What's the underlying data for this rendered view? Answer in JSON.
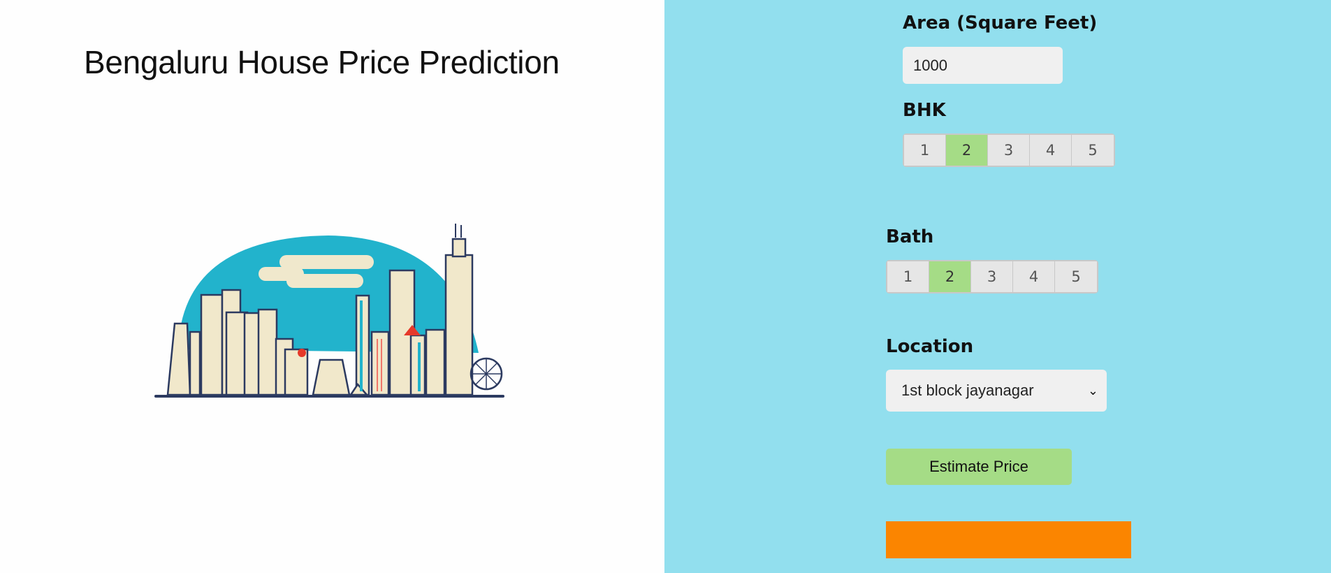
{
  "header": {
    "title": "Bengaluru House Price Prediction"
  },
  "illustration": {
    "icon": "bangalore-skyline-illustration"
  },
  "form": {
    "area": {
      "label": "Area (Square Feet)",
      "value": "1000"
    },
    "bhk": {
      "label": "BHK",
      "options": [
        "1",
        "2",
        "3",
        "4",
        "5"
      ],
      "selected": "2"
    },
    "bath": {
      "label": "Bath",
      "options": [
        "1",
        "2",
        "3",
        "4",
        "5"
      ],
      "selected": "2"
    },
    "location": {
      "label": "Location",
      "selected": "1st block jayanagar",
      "icon": "chevron-down-icon"
    },
    "estimate_label": "Estimate Price",
    "result_text": ""
  },
  "colors": {
    "right_panel_bg": "#92dfee",
    "active_option": "#a5dc86",
    "button_bg": "#a5dc86",
    "result_bg": "#fb8500"
  }
}
